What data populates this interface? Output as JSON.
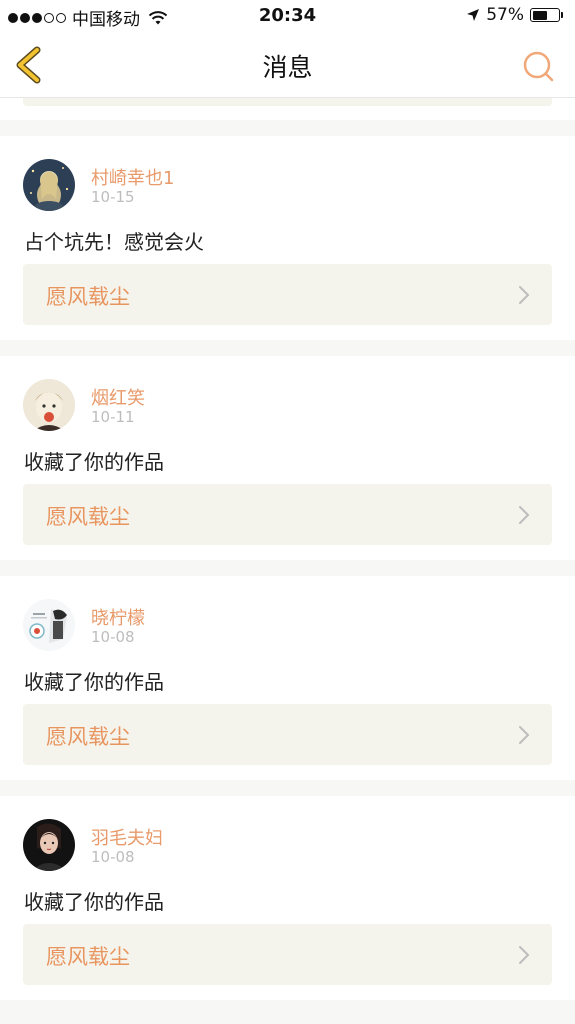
{
  "status_bar": {
    "carrier": "中国移动",
    "time": "20:34",
    "battery": "57%",
    "signal_bars_filled": 3,
    "signal_bars_total": 5
  },
  "nav": {
    "title": "消息",
    "back_icon": "chevron-left-icon",
    "search_icon": "search-icon"
  },
  "colors": {
    "accent": "#e89a6a",
    "link_bg": "#f4f3ec",
    "date": "#bdbdbd"
  },
  "messages": [
    {
      "username": "村崎幸也1",
      "date": "10-15",
      "text": "占个坑先！感觉会火",
      "work_title": "愿风载尘"
    },
    {
      "username": "烟红笑",
      "date": "10-11",
      "text": "收藏了你的作品",
      "work_title": "愿风载尘"
    },
    {
      "username": "晓柠檬",
      "date": "10-08",
      "text": "收藏了你的作品",
      "work_title": "愿风载尘"
    },
    {
      "username": "羽毛夫妇",
      "date": "10-08",
      "text": "收藏了你的作品",
      "work_title": "愿风载尘"
    }
  ]
}
